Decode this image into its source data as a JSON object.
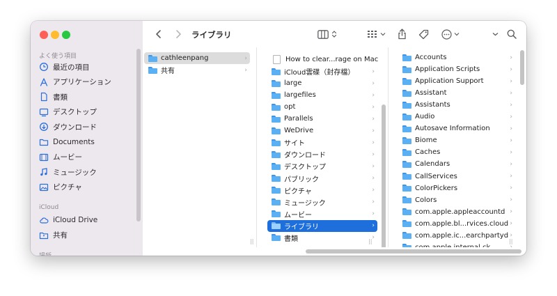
{
  "toolbar": {
    "back_icon": "chevron-left-icon",
    "forward_icon": "chevron-right-icon",
    "title": "ライブラリ",
    "view_icon": "column-view-icon",
    "group_icon": "grid-group-icon",
    "share_icon": "share-icon",
    "tag_icon": "tag-icon",
    "more_icon": "ellipsis-circle-icon",
    "search_icon": "search-icon"
  },
  "sidebar": {
    "favorites_header": "よく使う項目",
    "favorites": [
      {
        "label": "最近の項目",
        "icon": "clock-icon"
      },
      {
        "label": "アプリケーション",
        "icon": "apps-icon"
      },
      {
        "label": "書類",
        "icon": "document-icon"
      },
      {
        "label": "デスクトップ",
        "icon": "desktop-icon"
      },
      {
        "label": "ダウンロード",
        "icon": "download-icon"
      },
      {
        "label": "Documents",
        "icon": "folder-icon"
      },
      {
        "label": "ムービー",
        "icon": "film-icon"
      },
      {
        "label": "ミュージック",
        "icon": "music-icon"
      },
      {
        "label": "ピクチャ",
        "icon": "photo-icon"
      }
    ],
    "icloud_header": "iCloud",
    "icloud": [
      {
        "label": "iCloud Drive",
        "icon": "cloud-icon"
      },
      {
        "label": "共有",
        "icon": "shared-folder-icon"
      }
    ],
    "places_header": "場所"
  },
  "column1": [
    {
      "label": "cathleenpang",
      "kind": "folder",
      "state": "highlighted"
    },
    {
      "label": "共有",
      "kind": "folder",
      "state": "normal"
    }
  ],
  "column2": [
    {
      "label": "How to clear...rage on Mac",
      "kind": "doc",
      "state": "normal"
    },
    {
      "label": "iCloud雲碟（封存檔）",
      "kind": "folder",
      "state": "normal"
    },
    {
      "label": "large",
      "kind": "folder",
      "state": "normal"
    },
    {
      "label": "largefiles",
      "kind": "folder",
      "state": "normal"
    },
    {
      "label": "opt",
      "kind": "folder",
      "state": "normal"
    },
    {
      "label": "Parallels",
      "kind": "folder",
      "state": "normal"
    },
    {
      "label": "WeDrive",
      "kind": "folder",
      "state": "normal"
    },
    {
      "label": "サイト",
      "kind": "folder",
      "state": "normal"
    },
    {
      "label": "ダウンロード",
      "kind": "folder",
      "state": "normal"
    },
    {
      "label": "デスクトップ",
      "kind": "folder",
      "state": "normal"
    },
    {
      "label": "パブリック",
      "kind": "folder",
      "state": "normal"
    },
    {
      "label": "ピクチャ",
      "kind": "folder",
      "state": "normal"
    },
    {
      "label": "ミュージック",
      "kind": "folder",
      "state": "normal"
    },
    {
      "label": "ムービー",
      "kind": "folder",
      "state": "normal"
    },
    {
      "label": "ライブラリ",
      "kind": "folder",
      "state": "selected"
    },
    {
      "label": "書類",
      "kind": "folder",
      "state": "normal"
    }
  ],
  "column3": [
    {
      "label": "Accounts"
    },
    {
      "label": "Application Scripts"
    },
    {
      "label": "Application Support"
    },
    {
      "label": "Assistant"
    },
    {
      "label": "Assistants"
    },
    {
      "label": "Audio"
    },
    {
      "label": "Autosave Information"
    },
    {
      "label": "Biome"
    },
    {
      "label": "Caches"
    },
    {
      "label": "Calendars"
    },
    {
      "label": "CallServices"
    },
    {
      "label": "ColorPickers"
    },
    {
      "label": "Colors"
    },
    {
      "label": "com.apple.appleaccountd"
    },
    {
      "label": "com.apple.bl...rvices.cloud"
    },
    {
      "label": "com.apple.ic...earchpartyd"
    },
    {
      "label": "com.apple.internal.ck"
    }
  ],
  "glyphs": {
    "chevron": "›",
    "resize": "||",
    "back": "‹",
    "forward": "›"
  }
}
